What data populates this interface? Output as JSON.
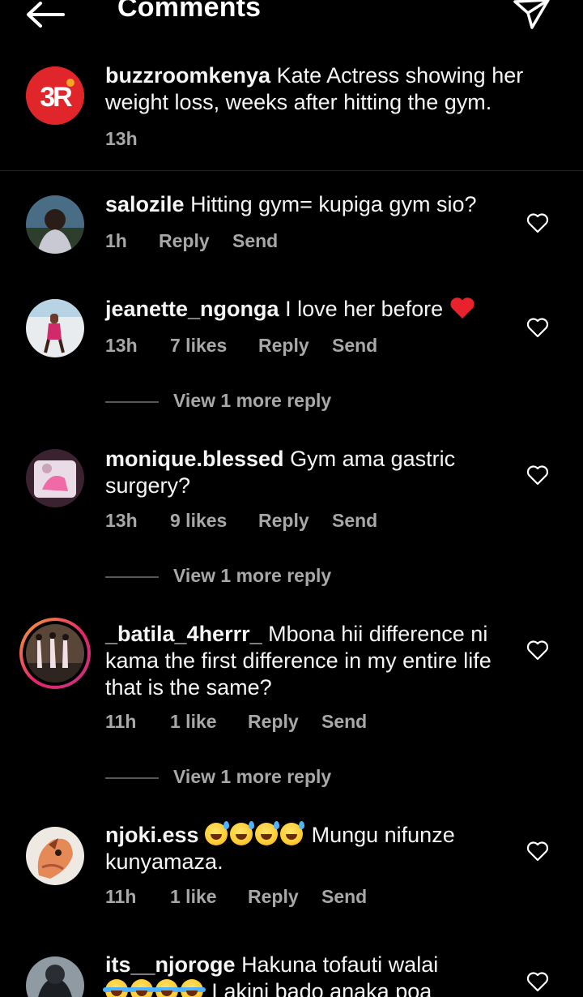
{
  "header": {
    "title": "Comments"
  },
  "caption": {
    "username": "buzzroomkenya",
    "text": "Kate Actress showing her weight loss, weeks after hitting the gym.",
    "time": "13h",
    "avatar_initials": "BR"
  },
  "actions": {
    "reply": "Reply",
    "send": "Send"
  },
  "comments": [
    {
      "username": "salozile",
      "text": "Hitting gym= kupiga gym  sio?",
      "time": "1h",
      "likes": ""
    },
    {
      "username": "jeanette_ngonga",
      "text": "I love her before",
      "time": "13h",
      "likes": "7 likes",
      "view_replies": "View 1 more reply"
    },
    {
      "username": "monique.blessed",
      "text": "Gym ama gastric surgery?",
      "time": "13h",
      "likes": "9 likes",
      "view_replies": "View 1 more reply"
    },
    {
      "username": "_batila_4herrr_",
      "text": "Mbona hii difference ni kama the first difference in my entire life that is the same?",
      "time": "11h",
      "likes": "1 like",
      "view_replies": "View 1 more reply"
    },
    {
      "username": "njoki.ess",
      "text": "Mungu nifunze kunyamaza.",
      "time": "11h",
      "likes": "1 like"
    },
    {
      "username": "its__njoroge",
      "text": "Hakuna  tofauti  walai",
      "text_line2": "Lakini  bado  anaka  poa",
      "time": "",
      "likes": ""
    }
  ],
  "icons": {
    "back": "arrow-left-icon",
    "direct": "paper-plane-icon",
    "like": "heart-outline-icon",
    "heart_emoji": "red-heart-emoji",
    "sweat_smile": "grinning-face-with-sweat-emoji",
    "tears_of_joy": "face-with-tears-of-joy-emoji"
  },
  "colors": {
    "background": "#000000",
    "text": "#ffffff",
    "secondary": "#a8a8a8",
    "brand_red": "#e0252b"
  }
}
